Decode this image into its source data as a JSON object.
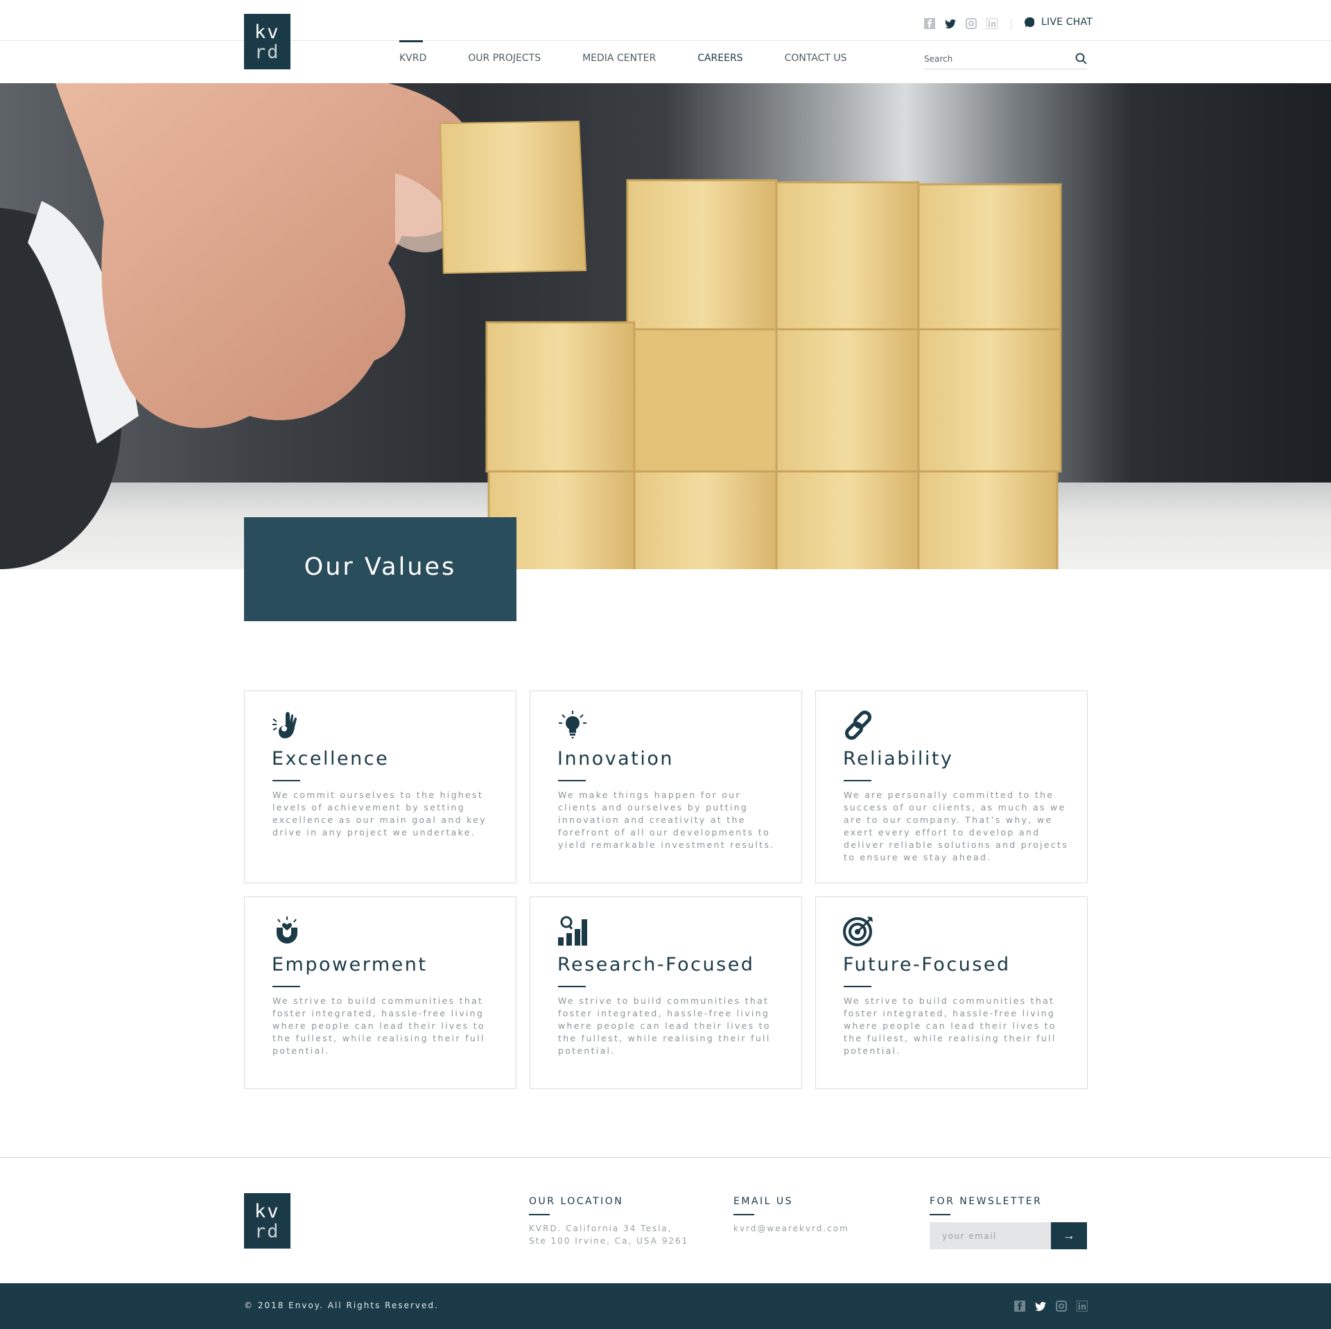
{
  "brand": {
    "logo_line1": "kv",
    "logo_line2": "rd"
  },
  "header": {
    "social": [
      "facebook-icon",
      "twitter-icon",
      "instagram-icon",
      "linkedin-icon"
    ],
    "live_chat": "LIVE CHAT",
    "nav": [
      "KVRD",
      "OUR PROJECTS",
      "MEDIA CENTER",
      "CAREERS",
      "CONTACT US"
    ],
    "search_placeholder": "Search"
  },
  "hero": {
    "title": "Our Values"
  },
  "values": [
    {
      "icon": "ok-hand-icon",
      "title": "Excellence",
      "text": "We commit ourselves to the highest levels of achievement by setting excellence as our main goal and key drive in any project we undertake."
    },
    {
      "icon": "lightbulb-icon",
      "title": "Innovation",
      "text": "We make things happen for our clients and ourselves by putting innovation and creativity at the forefront of all our developments to yield remarkable investment results."
    },
    {
      "icon": "chain-link-icon",
      "title": "Reliability",
      "text": "We are personally committed to the success of our clients, as much as we are to our company. That’s why, we exert every effort to develop and deliver reliable solutions and projects to ensure we stay ahead."
    },
    {
      "icon": "magnet-heart-icon",
      "title": "Empowerment",
      "text": "We strive to build communities that foster integrated, hassle-free living where people can lead their lives to the fullest, while realising their full potential."
    },
    {
      "icon": "research-chart-icon",
      "title": "Research-Focused",
      "text": "We strive to build communities that foster integrated, hassle-free living where people can lead their lives to the fullest, while realising their full potential."
    },
    {
      "icon": "target-icon",
      "title": "Future-Focused",
      "text": "We strive to build communities that foster integrated, hassle-free living where people can lead their lives to the fullest, while realising their full potential."
    }
  ],
  "footer": {
    "location_title": "OUR LOCATION",
    "location_line1": "KVRD. California 34 Tesla,",
    "location_line2": "Ste 100 Irvine, Ca, USA 9261",
    "email_title": "EMAIL US",
    "email": "kvrd@wearekvrd.com",
    "newsletter_title": "FOR NEWSLETTER",
    "newsletter_placeholder": "your email",
    "newsletter_button": "→",
    "copyright": "© 2018 Envoy. All Rights Reserved."
  },
  "colors": {
    "primary": "#1b3a47",
    "hero_box": "#2a4d5b",
    "muted_text": "#8c9397"
  }
}
